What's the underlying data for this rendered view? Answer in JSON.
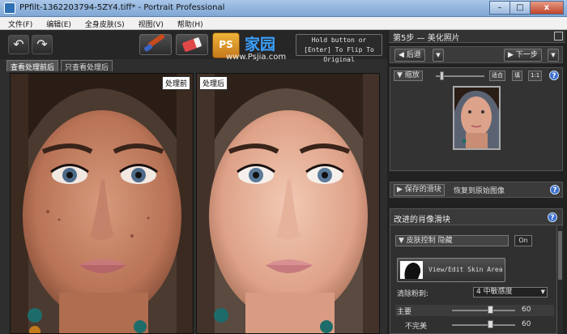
{
  "window": {
    "title": "PPfilt-1362203794-5ZY4.tiff* - Portrait Professional",
    "minimize": "–",
    "maximize": "□",
    "close": "x"
  },
  "menu": [
    "文件(F)",
    "编辑(E)",
    "全身皮肤(S)",
    "视图(V)",
    "帮助(H)"
  ],
  "toolbar": {
    "undo_glyph": "↶",
    "redo_glyph": "↷",
    "hold_text": "Hold button or [Enter] To Flip To Original"
  },
  "watermark": {
    "badge": "PS",
    "name": "家园",
    "site": "www.Psjia.com"
  },
  "tabs": [
    "查看处理前后",
    "只查看处理后"
  ],
  "photos": {
    "before_label": "处理前",
    "after_label": "处理后"
  },
  "right": {
    "step_title": "第5步 — 美化照片",
    "nav_back": "◀ 后退",
    "nav_next": "▶ 下一步",
    "zoom_label": "▼ 缩放",
    "zoom_btns": [
      "适合",
      "填",
      "1:1"
    ],
    "saved_sliders": "▶ 保存的滑块",
    "restore_label": "恢复到原始图像",
    "adv_title": "改进的肖像滑块",
    "skin_section": "▼ 皮肤控制 隐藏",
    "skin_on": "On",
    "area_label": "View/Edit Skin Area",
    "smoothing_label": "清除粉刺:",
    "smoothing_value": "4 中敏感度",
    "main_label": "主要",
    "main_value": "60",
    "imperfections_label": "不完美",
    "imperfections_value": "60",
    "help": "?"
  },
  "sliders": {
    "main": 0.6,
    "imperfections": 0.6,
    "zoom": 0.1
  },
  "colors": {
    "accent": "#3b6fd1",
    "panel": "#303030",
    "bg": "#1a1a1a"
  }
}
